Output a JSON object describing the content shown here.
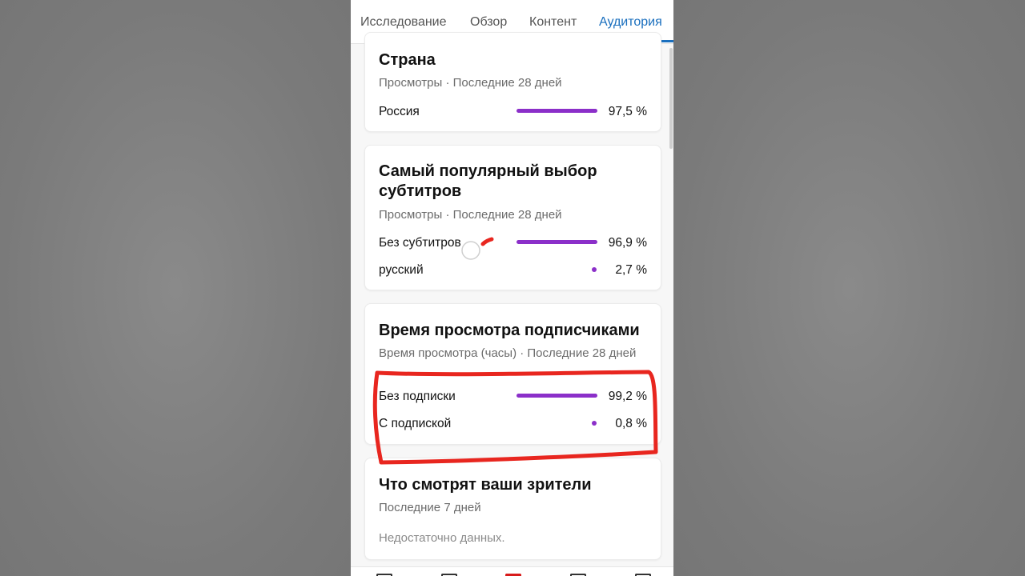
{
  "tabs": [
    {
      "label": "Исследование",
      "active": false
    },
    {
      "label": "Обзор",
      "active": false
    },
    {
      "label": "Контент",
      "active": false
    },
    {
      "label": "Аудитория",
      "active": true
    }
  ],
  "country_card": {
    "title": "Страна",
    "subtitle": "Просмотры · Последние 28 дней",
    "rows": [
      {
        "label": "Россия",
        "value": "97,5 %",
        "percent": 97.5
      }
    ]
  },
  "subtitles_card": {
    "title": "Самый популярный выбор субтитров",
    "subtitle": "Просмотры · Последние 28 дней",
    "rows": [
      {
        "label": "Без субтитров",
        "value": "96,9 %",
        "percent": 96.9
      },
      {
        "label": "русский",
        "value": "2,7 %",
        "percent": 2.7
      }
    ]
  },
  "subscribers_card": {
    "title": "Время просмотра подписчиками",
    "subtitle": "Время просмотра (часы) · Последние 28 дней",
    "rows": [
      {
        "label": "Без подписки",
        "value": "99,2 %",
        "percent": 99.2
      },
      {
        "label": "С подпиской",
        "value": "0,8 %",
        "percent": 0.8
      }
    ]
  },
  "viewers_card": {
    "title": "Что смотрят ваши зрители",
    "subtitle": "Последние 7 дней",
    "empty_text": "Недостаточно данных."
  },
  "colors": {
    "accent": "#1a6fbe",
    "bar": "#8b2fc9",
    "annotation": "#e8261f"
  },
  "bottom_nav": {
    "icons": [
      "home-icon",
      "shorts-icon",
      "create-icon",
      "subscriptions-icon",
      "library-icon"
    ]
  }
}
